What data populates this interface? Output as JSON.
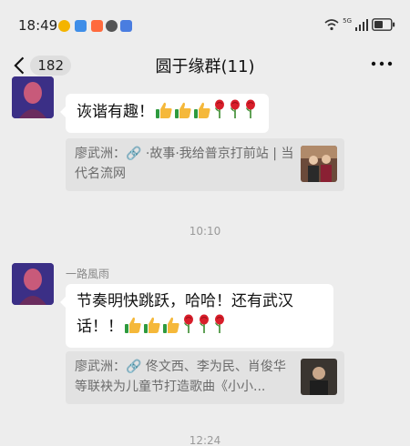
{
  "status_bar": {
    "time": "18:49",
    "network": "5G"
  },
  "nav": {
    "unread_count": "182",
    "title": "圆于缘群(11)"
  },
  "messages": [
    {
      "text": "诙谐有趣！",
      "emoji": [
        "thumbs-up",
        "thumbs-up",
        "thumbs-up",
        "rose",
        "rose",
        "rose"
      ],
      "quote": {
        "text": "廖武洲：🔗 ·故事·我给普京打前站 | 当代名流网"
      }
    },
    {
      "sender": "一路風雨",
      "text": "节奏明快跳跃，哈哈！还有武汉话！！",
      "emoji": [
        "thumbs-up",
        "thumbs-up",
        "thumbs-up",
        "rose",
        "rose",
        "rose"
      ],
      "quote": {
        "text": "廖武洲：🔗 佟文西、李为民、肖俊华等联袂为儿童节打造歌曲《小小..."
      }
    }
  ],
  "timestamps": [
    "10:10",
    "12:24"
  ],
  "colors": {
    "background": "#ededed",
    "bubble": "#ffffff",
    "quote_bg": "#e2e2e2"
  }
}
